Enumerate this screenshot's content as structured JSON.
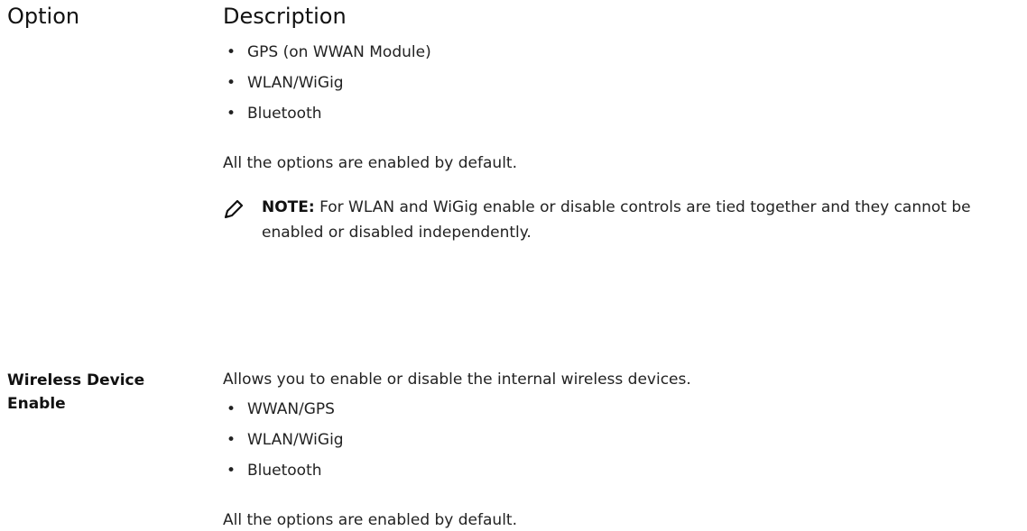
{
  "header": {
    "option": "Option",
    "description": "Description"
  },
  "first_block": {
    "items": [
      "GPS (on WWAN Module)",
      "WLAN/WiGig",
      "Bluetooth"
    ],
    "default_text": "All the options are enabled by default."
  },
  "note": {
    "label": "NOTE:",
    "text": "For WLAN and WiGig enable or disable controls are tied together and they cannot be enabled or disabled independently.",
    "icon": "pencil-icon"
  },
  "wireless_device_enable": {
    "name_line1": "Wireless Device",
    "name_line2": "Enable",
    "description": "Allows you to enable or disable the internal wireless devices.",
    "items": [
      "WWAN/GPS",
      "WLAN/WiGig",
      "Bluetooth"
    ],
    "default_text": "All the options are enabled by default."
  }
}
